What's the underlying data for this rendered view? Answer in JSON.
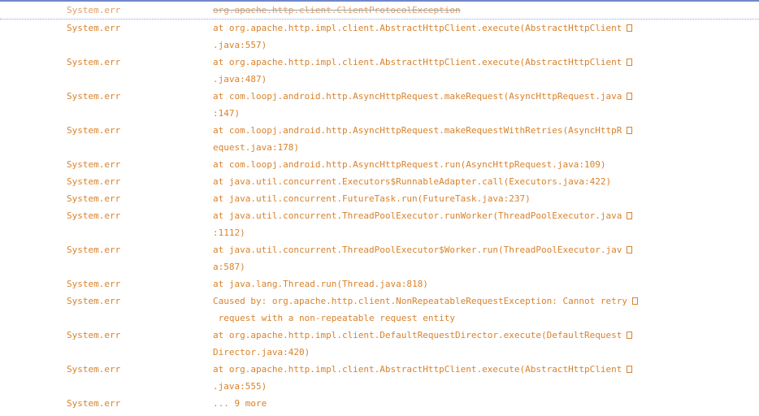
{
  "log": {
    "rows": [
      {
        "tag": "System.err",
        "lines": [
          "org.apache.http.client.ClientProtocolException"
        ],
        "wrapped": false,
        "selected": true
      },
      {
        "tag": "System.err",
        "lines": [
          "at org.apache.http.impl.client.AbstractHttpClient.execute(AbstractHttpClient",
          ".java:557)"
        ],
        "wrapped": true
      },
      {
        "tag": "System.err",
        "lines": [
          "at org.apache.http.impl.client.AbstractHttpClient.execute(AbstractHttpClient",
          ".java:487)"
        ],
        "wrapped": true
      },
      {
        "tag": "System.err",
        "lines": [
          "at com.loopj.android.http.AsyncHttpRequest.makeRequest(AsyncHttpRequest.java",
          ":147)"
        ],
        "wrapped": true
      },
      {
        "tag": "System.err",
        "lines": [
          "at com.loopj.android.http.AsyncHttpRequest.makeRequestWithRetries(AsyncHttpR",
          "equest.java:178)"
        ],
        "wrapped": true
      },
      {
        "tag": "System.err",
        "lines": [
          "at com.loopj.android.http.AsyncHttpRequest.run(AsyncHttpRequest.java:109)"
        ],
        "wrapped": false
      },
      {
        "tag": "System.err",
        "lines": [
          "at java.util.concurrent.Executors$RunnableAdapter.call(Executors.java:422)"
        ],
        "wrapped": false
      },
      {
        "tag": "System.err",
        "lines": [
          "at java.util.concurrent.FutureTask.run(FutureTask.java:237)"
        ],
        "wrapped": false
      },
      {
        "tag": "System.err",
        "lines": [
          "at java.util.concurrent.ThreadPoolExecutor.runWorker(ThreadPoolExecutor.java",
          ":1112)"
        ],
        "wrapped": true
      },
      {
        "tag": "System.err",
        "lines": [
          "at java.util.concurrent.ThreadPoolExecutor$Worker.run(ThreadPoolExecutor.jav",
          "a:587)"
        ],
        "wrapped": true
      },
      {
        "tag": "System.err",
        "lines": [
          "at java.lang.Thread.run(Thread.java:818)"
        ],
        "wrapped": false
      },
      {
        "tag": "System.err",
        "lines": [
          "Caused by: org.apache.http.client.NonRepeatableRequestException: Cannot retry",
          " request with a non-repeatable request entity"
        ],
        "wrapped": true
      },
      {
        "tag": "System.err",
        "lines": [
          "at org.apache.http.impl.client.DefaultRequestDirector.execute(DefaultRequest",
          "Director.java:420)"
        ],
        "wrapped": true
      },
      {
        "tag": "System.err",
        "lines": [
          "at org.apache.http.impl.client.AbstractHttpClient.execute(AbstractHttpClient",
          ".java:555)"
        ],
        "wrapped": true
      },
      {
        "tag": "System.err",
        "lines": [
          "... 9 more"
        ],
        "wrapped": false
      }
    ]
  }
}
